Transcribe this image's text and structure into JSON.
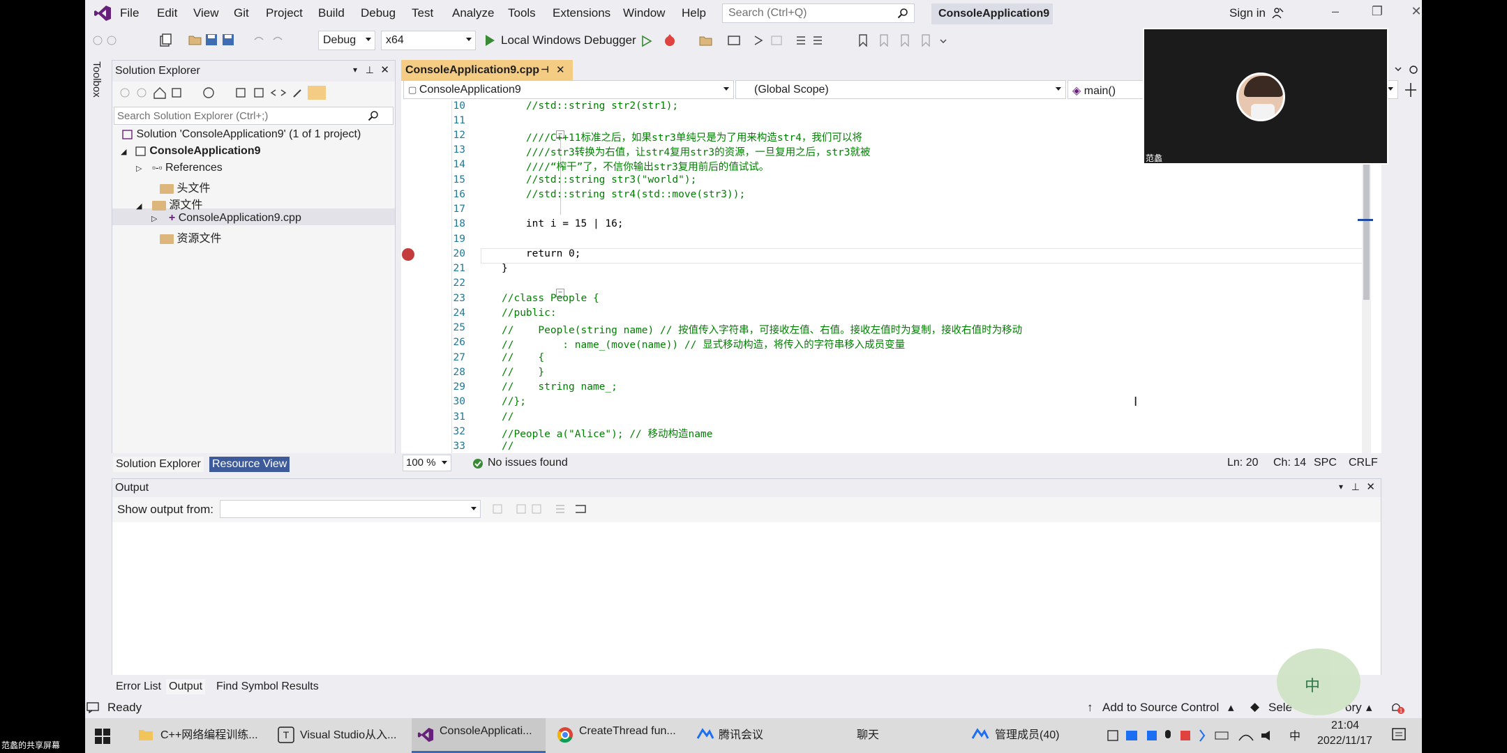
{
  "menu": [
    "File",
    "Edit",
    "View",
    "Git",
    "Project",
    "Build",
    "Debug",
    "Test",
    "Analyze",
    "Tools",
    "Extensions",
    "Window",
    "Help"
  ],
  "search": {
    "placeholder": "Search (Ctrl+Q)"
  },
  "window_title": "ConsoleApplication9",
  "signin": "Sign in",
  "toolbar": {
    "config": "Debug",
    "platform": "x64",
    "debugger": "Local Windows Debugger"
  },
  "toolbox_label": "Toolbox",
  "solution_explorer": {
    "title": "Solution Explorer",
    "search_placeholder": "Search Solution Explorer (Ctrl+;)",
    "items": [
      "Solution 'ConsoleApplication9' (1 of 1 project)",
      "ConsoleApplication9",
      "References",
      "头文件",
      "源文件",
      "ConsoleApplication9.cpp",
      "资源文件"
    ],
    "tabs": [
      "Solution Explorer",
      "Resource View"
    ]
  },
  "editor": {
    "tab": "ConsoleApplication9.cpp",
    "nav_project": "ConsoleApplication9",
    "nav_scope": "(Global Scope)",
    "nav_member": "main()",
    "lines": [
      {
        "n": "10",
        "t": "    //std::string str2(str1);",
        "c": "cm"
      },
      {
        "n": "11",
        "t": "",
        "c": "tx"
      },
      {
        "n": "12",
        "t": "    ////C++11标准之后，如果str3单纯只是为了用来构造str4，我们可以将",
        "c": "cm"
      },
      {
        "n": "13",
        "t": "    ////str3转换为右值，让str4复用str3的资源，一旦复用之后，str3就被",
        "c": "cm"
      },
      {
        "n": "14",
        "t": "    ////“榨干”了，不信你输出str3复用前后的值试试。",
        "c": "cm"
      },
      {
        "n": "15",
        "t": "    //std::string str3(\"world\");",
        "c": "cm"
      },
      {
        "n": "16",
        "t": "    //std::string str4(std::move(str3));",
        "c": "cm"
      },
      {
        "n": "17",
        "t": "",
        "c": "tx"
      },
      {
        "n": "18",
        "t": "    int i = 15 | 16;",
        "c": "tx"
      },
      {
        "n": "19",
        "t": "",
        "c": "tx"
      },
      {
        "n": "20",
        "t": "    return 0;",
        "c": "tx"
      },
      {
        "n": "21",
        "t": "}",
        "c": "tx"
      },
      {
        "n": "22",
        "t": "",
        "c": "tx"
      },
      {
        "n": "23",
        "t": "//class People {",
        "c": "cm"
      },
      {
        "n": "24",
        "t": "//public:",
        "c": "cm"
      },
      {
        "n": "25",
        "t": "//    People(string name) // 按值传入字符串，可接收左值、右值。接收左值时为复制，接收右值时为移动",
        "c": "cm"
      },
      {
        "n": "26",
        "t": "//        : name_(move(name)) // 显式移动构造，将传入的字符串移入成员变量",
        "c": "cm"
      },
      {
        "n": "27",
        "t": "//    {",
        "c": "cm"
      },
      {
        "n": "28",
        "t": "//    }",
        "c": "cm"
      },
      {
        "n": "29",
        "t": "//    string name_;",
        "c": "cm"
      },
      {
        "n": "30",
        "t": "//};",
        "c": "cm"
      },
      {
        "n": "31",
        "t": "//",
        "c": "cm"
      },
      {
        "n": "32",
        "t": "//People a(\"Alice\"); // 移动构造name",
        "c": "cm"
      },
      {
        "n": "33",
        "t": "//",
        "c": "cm"
      }
    ],
    "zoom": "100 %",
    "issues": "No issues found",
    "ln": "Ln: 20",
    "ch": "Ch: 14",
    "spc": "SPC",
    "crlf": "CRLF"
  },
  "output": {
    "title": "Output",
    "show_from": "Show output from:",
    "tabs": [
      "Error List",
      "Output",
      "Find Symbol Results"
    ]
  },
  "status": {
    "ready": "Ready",
    "source_control": "Add to Source Control",
    "select": "Sele",
    "repo": "ory"
  },
  "taskbar": {
    "items": [
      "C++网络编程训练...",
      "Visual Studio从入...",
      "ConsoleApplicati...",
      "CreateThread fun...",
      "腾讯会议",
      "聊天",
      "管理成员(40)"
    ],
    "time": "21:04",
    "date": "2022/11/17",
    "ime": "中"
  },
  "video": {
    "name": "范蠡"
  },
  "share_label": "范蠡的共享屏幕",
  "colors": {
    "accent": "#68217a",
    "tab_active": "#f5cc84",
    "comment": "#008000",
    "keyword": "#0000ff",
    "breakpoint": "#c43b3b"
  }
}
